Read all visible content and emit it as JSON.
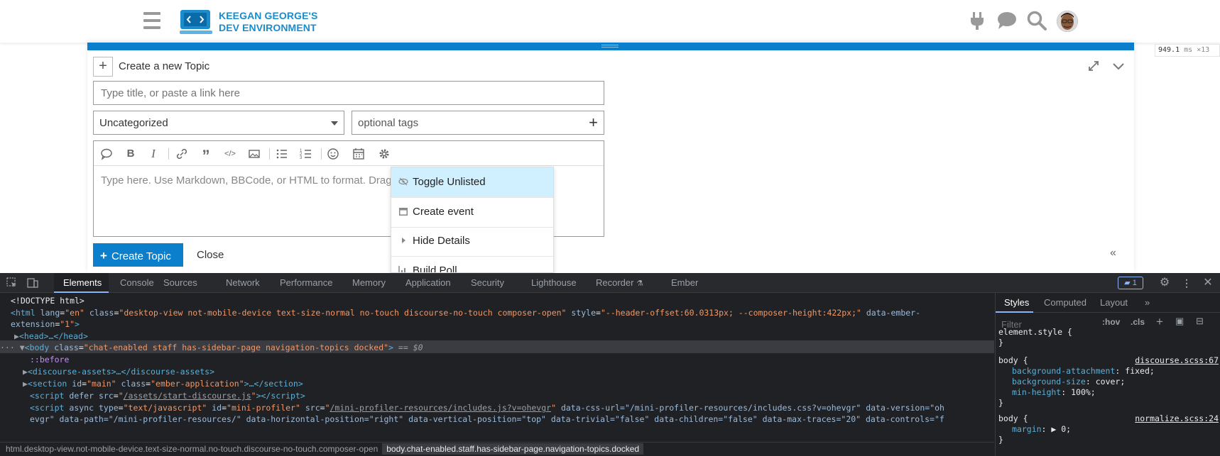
{
  "header": {
    "site_title_line1": "KEEGAN GEORGE'S",
    "site_title_line2": "DEV ENVIRONMENT",
    "icons": [
      "hamburger-icon",
      "plug-icon",
      "chat-icon",
      "search-icon",
      "avatar"
    ]
  },
  "profiler": {
    "time": "949.1",
    "unit": "ms",
    "count": "×13"
  },
  "composer": {
    "action_title": "Create a new Topic",
    "title_placeholder": "Type title, or paste a link here",
    "category_value": "Uncategorized",
    "tags_placeholder": "optional tags",
    "editor_placeholder": "Type here. Use Markdown, BBCode, or HTML to format. Drag or paste images.",
    "toolbar_icons": [
      "speech-bubble-icon",
      "bold-icon",
      "italic-icon",
      "link-icon",
      "quote-icon",
      "code-icon",
      "image-icon",
      "bullet-list-icon",
      "numbered-list-icon",
      "emoji-icon",
      "calendar-icon",
      "gear-icon"
    ],
    "popup_menu": [
      {
        "label": "Toggle Unlisted",
        "icon": "eye-slash-icon"
      },
      {
        "label": "Create event",
        "icon": "calendar-icon"
      },
      {
        "label": "Hide Details",
        "icon": "caret-right-icon"
      },
      {
        "label": "Build Poll",
        "icon": "chart-icon"
      }
    ],
    "create_button": "Create Topic",
    "close_link": "Close"
  },
  "devtools": {
    "tabs": [
      "Elements",
      "Console",
      "Sources",
      "Network",
      "Performance",
      "Memory",
      "Application",
      "Security",
      "Lighthouse",
      "Recorder",
      "Ember"
    ],
    "issues_count": "1",
    "dom": {
      "doctype": "<!DOCTYPE html>",
      "html_tag": "html",
      "html_lang": "\"en\"",
      "html_class": "\"desktop-view not-mobile-device text-size-normal no-touch discourse-no-touch composer-open\"",
      "html_style": "\"--header-offset:60.0313px; --composer-height:422px;\"",
      "html_ext": "data-ember-",
      "html_ext2": "extension",
      "html_ext2_val": "\"1\"",
      "head": "<head>…</head>",
      "body_class": "\"chat-enabled staff has-sidebar-page navigation-topics docked\"",
      "body_marker": "== $0",
      "before": "::before",
      "assets": "<discourse-assets>…</discourse-assets>",
      "section_id": "\"main\"",
      "section_class": "\"ember-application\"",
      "script1_src": "/assets/start-discourse.js",
      "script2_id": "\"mini-profiler\"",
      "script2_src": "/mini-profiler-resources/includes.js?v=ohevgr",
      "script2_rest": "data-css-url=\"/mini-profiler-resources/includes.css?v=ohevgr\" data-version=\"oh",
      "script2_line2": "evgr\" data-path=\"/mini-profiler-resources/\" data-horizontal-position=\"right\" data-vertical-position=\"top\" data-trivial=\"false\" data-children=\"false\" data-max-traces=\"20\" data-controls=\"f"
    },
    "styles": {
      "tabs": [
        "Styles",
        "Computed",
        "Layout"
      ],
      "filter_placeholder": "Filter",
      "hov": ":hov",
      "cls": ".cls",
      "element_style": "element.style {",
      "rule1_selector": "body {",
      "rule1_source": "discourse.scss:67",
      "rule1_props": [
        {
          "name": "background-attachment",
          "value": "fixed;"
        },
        {
          "name": "background-size",
          "value": "cover;"
        },
        {
          "name": "min-height",
          "value": "100%;"
        }
      ],
      "rule2_selector": "body {",
      "rule2_source": "normalize.scss:24",
      "rule2_prop_name": "margin",
      "rule2_prop_value": "▶ 0;"
    },
    "breadcrumbs": {
      "first": "html.desktop-view.not-mobile-device.text-size-normal.no-touch.discourse-no-touch.composer-open",
      "second": "body.chat-enabled.staff.has-sidebar-page.navigation-topics.docked"
    }
  }
}
